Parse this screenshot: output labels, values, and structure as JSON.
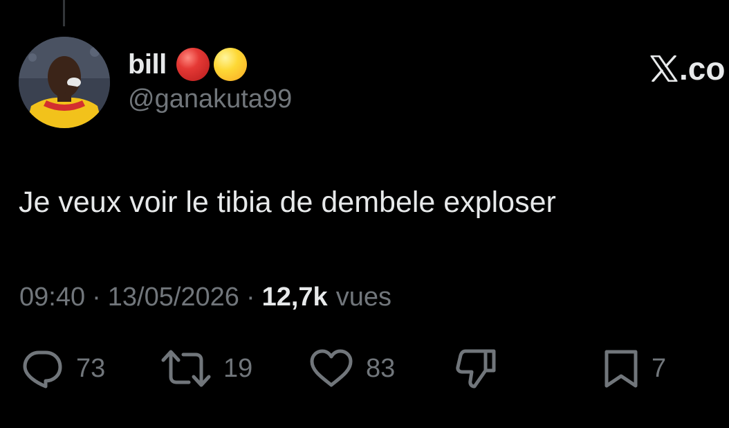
{
  "author": {
    "display_name": "bill",
    "name_emojis": [
      "red-circle",
      "yellow-circle"
    ],
    "handle": "@ganakuta99"
  },
  "watermark": {
    "text": ".co",
    "icon": "x-logo-icon"
  },
  "tweet": {
    "text": "Je veux voir le tibia de dembele exploser"
  },
  "meta": {
    "time": "09:40",
    "separator": "·",
    "date": "13/05/2026",
    "views_count": "12,7k",
    "views_label": "vues"
  },
  "actions": {
    "replies": {
      "icon": "reply-icon",
      "count": "73"
    },
    "reposts": {
      "icon": "repost-icon",
      "count": "19"
    },
    "likes": {
      "icon": "heart-icon",
      "count": "83"
    },
    "dislike": {
      "icon": "thumbs-down-icon"
    },
    "bookmarks": {
      "icon": "bookmark-icon",
      "count": "7"
    }
  },
  "colors": {
    "background": "#000000",
    "primary_text": "#e7e9ea",
    "secondary_text": "#71767b"
  }
}
